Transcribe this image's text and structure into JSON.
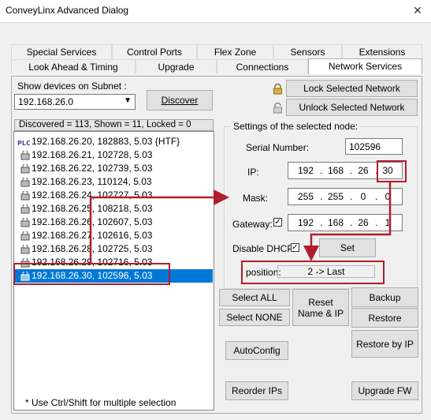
{
  "window": {
    "title": "ConveyLinx Advanced Dialog",
    "close_glyph": "✕"
  },
  "tabs_row1": [
    "Special Services",
    "Control Ports",
    "Flex Zone",
    "Sensors",
    "Extensions"
  ],
  "tabs_row2": [
    "Look Ahead & Timing",
    "Upgrade",
    "Connections",
    "Network Services"
  ],
  "subnet": {
    "label": "Show devices on Subnet :",
    "value": "192.168.26.0",
    "discover": "Discover"
  },
  "lock": {
    "lock_label": "Lock Selected Network",
    "unlock_label": "Unlock Selected Network"
  },
  "list": {
    "header": "Discovered = 113, Shown = 11, Locked = 0",
    "items": [
      "192.168.26.20, 182883, 5.03 {HTF}",
      "192.168.26.21, 102728, 5.03",
      "192.168.26.22, 102739, 5.03",
      "192.168.26.23, 110124, 5.03",
      "192.168.26.24, 102727, 5.03",
      "192.168.26.25, 108218, 5.03",
      "192.168.26.26, 102607, 5.03",
      "192.168.26.27, 102616, 5.03",
      "192.168.26.28, 102725, 5.03",
      "192.168.26.29, 102716, 5.03",
      "192.168.26.30, 102596, 5.03"
    ],
    "selected_index": 10,
    "footer": "* Use Ctrl/Shift for multiple selection"
  },
  "settings": {
    "title": "Settings of the selected node:",
    "serial_label": "Serial Number:",
    "serial_value": "102596",
    "ip_label": "IP:",
    "ip": [
      "192",
      "168",
      "26",
      "30"
    ],
    "mask_label": "Mask:",
    "mask": [
      "255",
      "255",
      "0",
      "0"
    ],
    "gateway_label": "Gateway:",
    "gateway": [
      "192",
      "168",
      "26",
      "1"
    ],
    "gateway_checked": true,
    "dhcp_label": "Disable DHCP",
    "dhcp_checked": true,
    "set_label": "Set",
    "position_label": "position:",
    "position_value": "2 -> Last"
  },
  "buttons": {
    "select_all": "Select ALL",
    "select_none": "Select NONE",
    "reset": "Reset\nName & IP",
    "backup": "Backup",
    "restore": "Restore",
    "restore_by_ip": "Restore by IP",
    "autoconfig": "AutoConfig",
    "reorder": "Reorder IPs",
    "upgrade_fw": "Upgrade FW"
  },
  "colors": {
    "selection": "#0078d7",
    "annotation": "#b01e2e"
  },
  "icons": {
    "plc": "plc-icon",
    "device": "device-lock-icon",
    "lock": "padlock-closed-icon",
    "unlock": "padlock-open-icon"
  }
}
